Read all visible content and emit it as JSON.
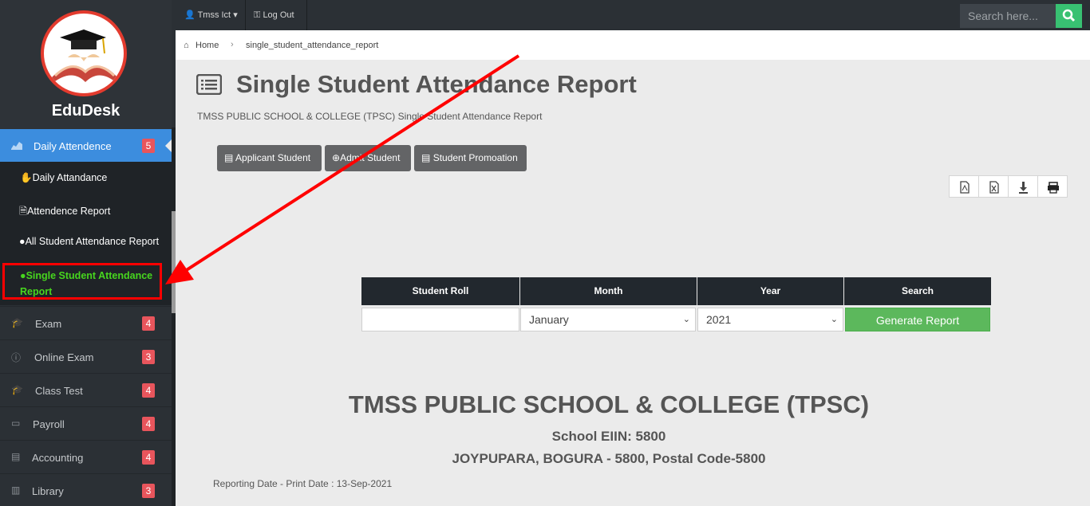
{
  "sidebar": {
    "brand": "EduDesk",
    "active_menu": {
      "label": "Daily Attendence",
      "badge": "5"
    },
    "submenu": [
      {
        "label": "Daily Attandance"
      },
      {
        "label": "Attendence Report"
      },
      {
        "label": "All Student Attendance Report"
      },
      {
        "label": "Single Student Attendance Report"
      }
    ],
    "menu": [
      {
        "label": "Exam",
        "badge": "4",
        "icon": "graduation-cap-icon"
      },
      {
        "label": "Online Exam",
        "badge": "3",
        "icon": "info-icon"
      },
      {
        "label": "Class Test",
        "badge": "4",
        "icon": "graduation-cap-icon"
      },
      {
        "label": "Payroll",
        "badge": "4",
        "icon": "money-icon"
      },
      {
        "label": "Accounting",
        "badge": "4",
        "icon": "briefcase-icon"
      },
      {
        "label": "Library",
        "badge": "3",
        "icon": "book-icon"
      }
    ]
  },
  "topbar": {
    "user": "Tmss Ict",
    "logout": "Log Out",
    "search_placeholder": "Search here..."
  },
  "breadcrumb": {
    "home": "Home",
    "current": "single_student_attendance_report"
  },
  "page": {
    "title": "Single Student Attendance Report",
    "subtitle": "TMSS PUBLIC SCHOOL & COLLEGE (TPSC) Single Student Attendance Report",
    "buttons": [
      "Applicant Student",
      "Admit Student",
      "Student Promoation"
    ]
  },
  "form": {
    "headers": [
      "Student Roll",
      "Month",
      "Year",
      "Search"
    ],
    "roll_value": "",
    "month": "January",
    "year": "2021",
    "generate": "Generate Report"
  },
  "report": {
    "school": "TMSS PUBLIC SCHOOL & COLLEGE (TPSC)",
    "eiin": "School EIIN: 5800",
    "address": "JOYPUPARA, BOGURA - 5800, Postal Code-5800",
    "reporting_date": "Reporting Date - Print Date : 13-Sep-2021"
  },
  "colors": {
    "active_menu": "#3c8dde",
    "highlight": "#ff0000",
    "active_sub": "#47d61e",
    "badge": "#e8555c",
    "generate": "#5cb85c"
  }
}
